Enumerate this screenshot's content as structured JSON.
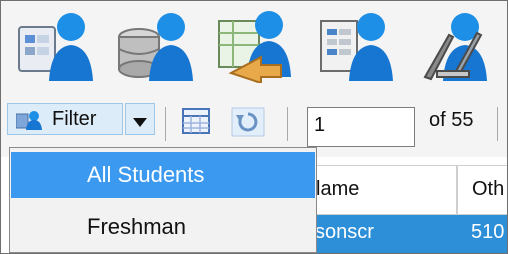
{
  "big_toolbar": {
    "icons": [
      "users-list-icon",
      "users-database-icon",
      "users-transfer-icon",
      "users-report-icon",
      "users-tools-icon"
    ]
  },
  "toolbar": {
    "filter_label": "Filter",
    "page_value": "1",
    "of_count": "of 55"
  },
  "dropdown": {
    "items": [
      "All Students",
      "Freshman"
    ],
    "selected_index": 0
  },
  "grid": {
    "columns": [
      "Name",
      "Oth"
    ],
    "visible_header_text": [
      "lame",
      "Oth"
    ],
    "row": [
      "sonscr",
      "510"
    ]
  },
  "colors": {
    "selection": "#3b9af0",
    "row_selected": "#2d8fd8",
    "toolbar_bg": "#f4f4f4"
  }
}
